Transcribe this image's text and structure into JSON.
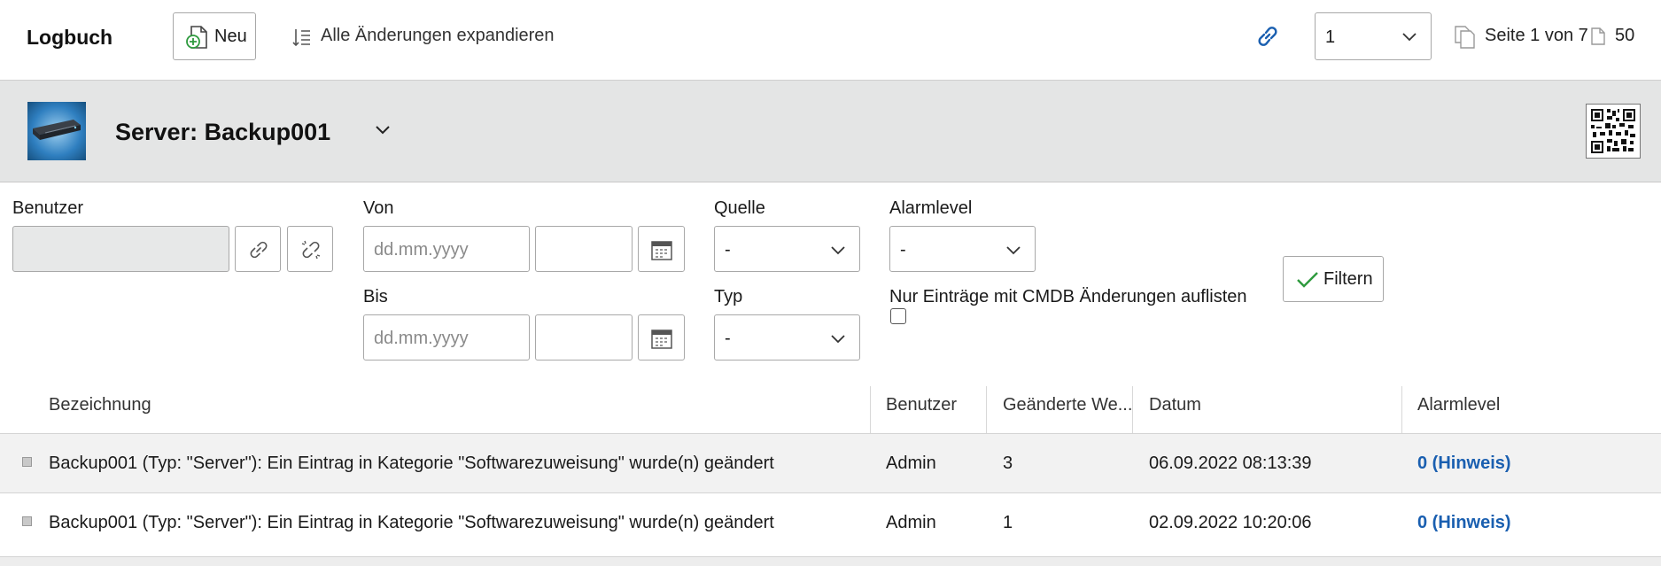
{
  "toolbar": {
    "title": "Logbuch",
    "new_label": "Neu",
    "expand_label": "Alle Änderungen expandieren",
    "page_select_value": "1",
    "page_info": "Seite 1 von 7",
    "page_size": "50"
  },
  "object": {
    "title": "Server: Backup001"
  },
  "filter": {
    "user_label": "Benutzer",
    "from_label": "Von",
    "to_label": "Bis",
    "date_placeholder": "dd.mm.yyyy",
    "source_label": "Quelle",
    "source_value": "-",
    "type_label": "Typ",
    "type_value": "-",
    "alarm_label": "Alarmlevel",
    "alarm_value": "-",
    "cmdb_only_label": "Nur Einträge mit CMDB Änderungen auflisten",
    "filter_button": "Filtern"
  },
  "table": {
    "columns": [
      "Bezeichnung",
      "Benutzer",
      "Geänderte We...",
      "Datum",
      "Alarmlevel"
    ],
    "rows": [
      {
        "description": "Backup001 (Typ: \"Server\"): Ein Eintrag in Kategorie \"Softwarezuweisung\" wurde(n) geändert",
        "user": "Admin",
        "changed": "3",
        "date": "06.09.2022 08:13:39",
        "alarm": "0 (Hinweis)"
      },
      {
        "description": "Backup001 (Typ: \"Server\"): Ein Eintrag in Kategorie \"Softwarezuweisung\" wurde(n) geändert",
        "user": "Admin",
        "changed": "1",
        "date": "02.09.2022 10:20:06",
        "alarm": "0 (Hinweis)"
      }
    ]
  },
  "colors": {
    "link_blue": "#1a5fb0",
    "header_gray": "#e4e5e5",
    "add_green": "#2e9a3e"
  },
  "icons": {
    "new": "document-plus-icon",
    "expand": "list-expand-icon",
    "link": "link-icon",
    "pages": "pages-icon",
    "page_size": "document-icon",
    "object": "server-image",
    "qr": "qr-code-icon",
    "unlink": "unlink-icon",
    "calendar": "calendar-icon",
    "filter": "check-icon"
  }
}
